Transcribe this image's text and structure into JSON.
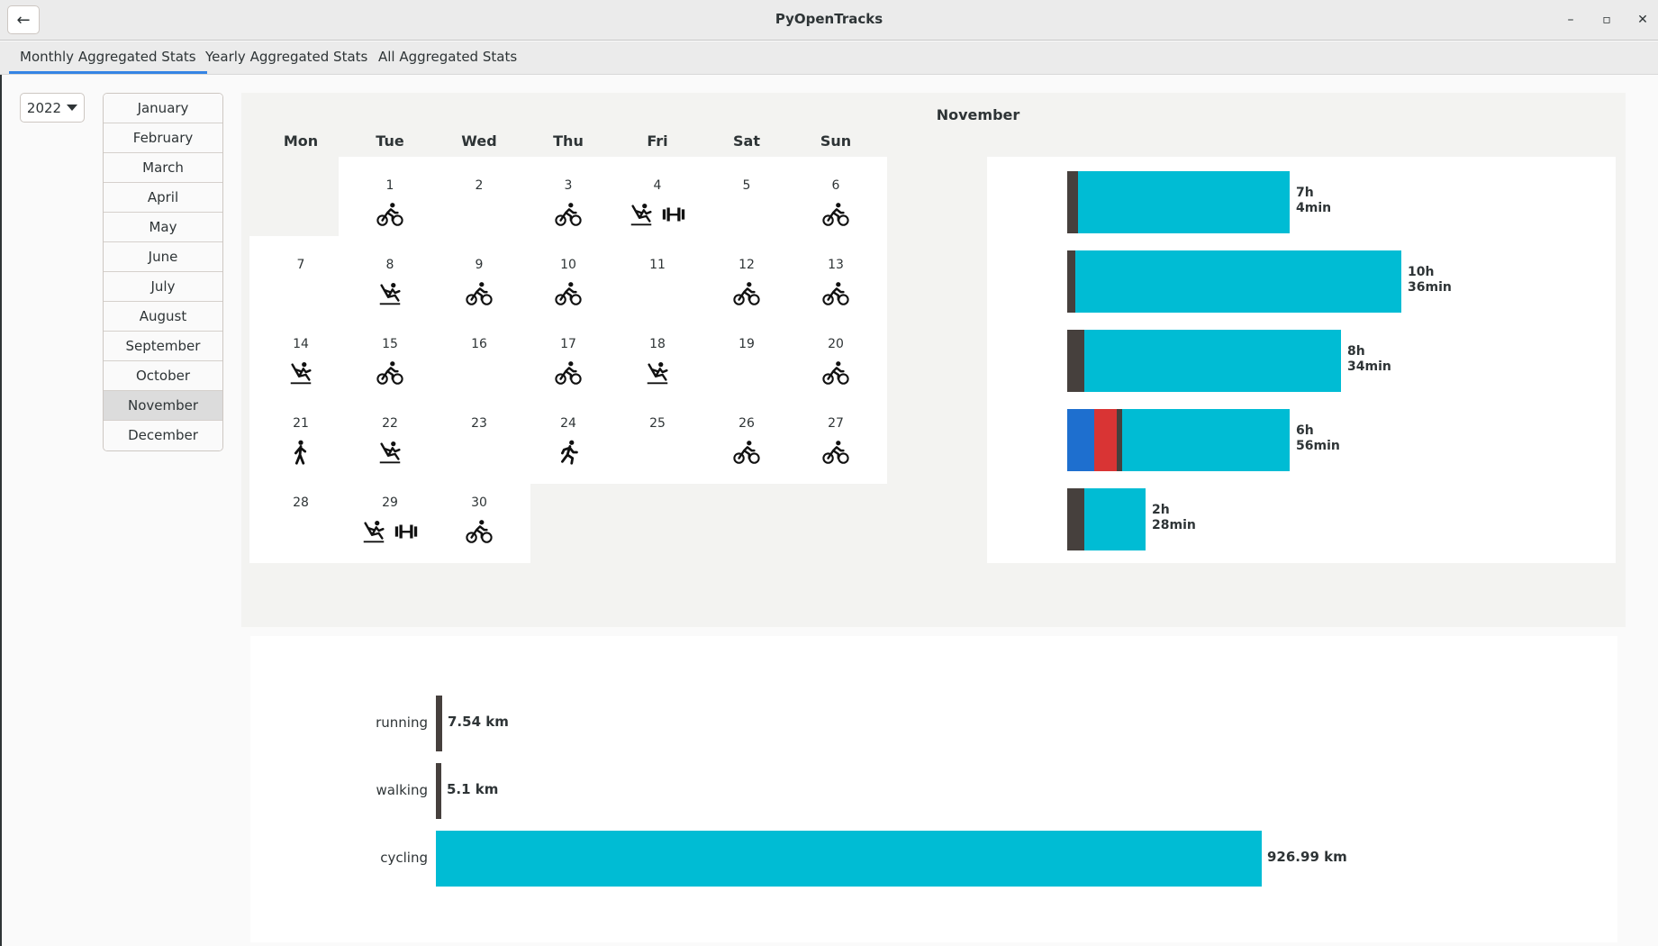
{
  "app": {
    "title": "PyOpenTracks",
    "back_icon": "arrow-left-icon"
  },
  "window_controls": {
    "minimize": "–",
    "maximize": "▫",
    "close": "✕"
  },
  "tabs": [
    {
      "label": "Monthly Aggregated Stats",
      "active": true
    },
    {
      "label": "Yearly Aggregated Stats",
      "active": false
    },
    {
      "label": "All Aggregated Stats",
      "active": false
    }
  ],
  "year_selector": {
    "value": "2022"
  },
  "months": [
    "January",
    "February",
    "March",
    "April",
    "May",
    "June",
    "July",
    "August",
    "September",
    "October",
    "November",
    "December"
  ],
  "selected_month": "November",
  "calendar": {
    "title": "November",
    "weekdays": [
      "Mon",
      "Tue",
      "Wed",
      "Thu",
      "Fri",
      "Sat",
      "Sun"
    ],
    "weeks": [
      [
        null,
        {
          "day": "1",
          "acts": [
            "cycling"
          ]
        },
        {
          "day": "2",
          "acts": []
        },
        {
          "day": "3",
          "acts": [
            "cycling"
          ]
        },
        {
          "day": "4",
          "acts": [
            "skiing",
            "gym"
          ]
        },
        {
          "day": "5",
          "acts": []
        },
        {
          "day": "6",
          "acts": [
            "cycling"
          ]
        }
      ],
      [
        {
          "day": "7",
          "acts": []
        },
        {
          "day": "8",
          "acts": [
            "skiing"
          ]
        },
        {
          "day": "9",
          "acts": [
            "cycling"
          ]
        },
        {
          "day": "10",
          "acts": [
            "cycling"
          ]
        },
        {
          "day": "11",
          "acts": []
        },
        {
          "day": "12",
          "acts": [
            "cycling"
          ]
        },
        {
          "day": "13",
          "acts": [
            "cycling"
          ]
        }
      ],
      [
        {
          "day": "14",
          "acts": [
            "skiing"
          ]
        },
        {
          "day": "15",
          "acts": [
            "cycling"
          ]
        },
        {
          "day": "16",
          "acts": []
        },
        {
          "day": "17",
          "acts": [
            "cycling"
          ]
        },
        {
          "day": "18",
          "acts": [
            "skiing"
          ]
        },
        {
          "day": "19",
          "acts": []
        },
        {
          "day": "20",
          "acts": [
            "cycling"
          ]
        }
      ],
      [
        {
          "day": "21",
          "acts": [
            "walking"
          ]
        },
        {
          "day": "22",
          "acts": [
            "skiing"
          ]
        },
        {
          "day": "23",
          "acts": []
        },
        {
          "day": "24",
          "acts": [
            "running"
          ]
        },
        {
          "day": "25",
          "acts": []
        },
        {
          "day": "26",
          "acts": [
            "cycling"
          ]
        },
        {
          "day": "27",
          "acts": [
            "cycling"
          ]
        }
      ],
      [
        {
          "day": "28",
          "acts": []
        },
        {
          "day": "29",
          "acts": [
            "skiing",
            "gym"
          ]
        },
        {
          "day": "30",
          "acts": [
            "cycling"
          ]
        },
        null,
        null,
        null,
        null
      ]
    ]
  },
  "weekly_totals": [
    {
      "hours": "7h",
      "minutes": "4min",
      "segments": [
        {
          "color": "#46403d",
          "frac": 0.017
        },
        {
          "color": "#00bcd4",
          "frac": 0.336
        }
      ]
    },
    {
      "hours": "10h",
      "minutes": "36min",
      "segments": [
        {
          "color": "#46403d",
          "frac": 0.013
        },
        {
          "color": "#00bcd4",
          "frac": 0.518
        }
      ]
    },
    {
      "hours": "8h",
      "minutes": "34min",
      "segments": [
        {
          "color": "#46403d",
          "frac": 0.027
        },
        {
          "color": "#00bcd4",
          "frac": 0.409
        }
      ]
    },
    {
      "hours": "6h",
      "minutes": "56min",
      "segments": [
        {
          "color": "#1e6fcf",
          "frac": 0.043
        },
        {
          "color": "#d93434",
          "frac": 0.036
        },
        {
          "color": "#46403d",
          "frac": 0.009
        },
        {
          "color": "#00bcd4",
          "frac": 0.266
        }
      ]
    },
    {
      "hours": "2h",
      "minutes": "28min",
      "segments": [
        {
          "color": "#46403d",
          "frac": 0.027
        },
        {
          "color": "#00bcd4",
          "frac": 0.098
        }
      ]
    }
  ],
  "distances": [
    {
      "label": "running",
      "value": "7.54 km",
      "km": 7.54,
      "color": "#46403d"
    },
    {
      "label": "walking",
      "value": "5.1 km",
      "km": 5.1,
      "color": "#46403d"
    },
    {
      "label": "cycling",
      "value": "926.99 km",
      "km": 926.99,
      "color": "#00bcd4"
    }
  ]
}
